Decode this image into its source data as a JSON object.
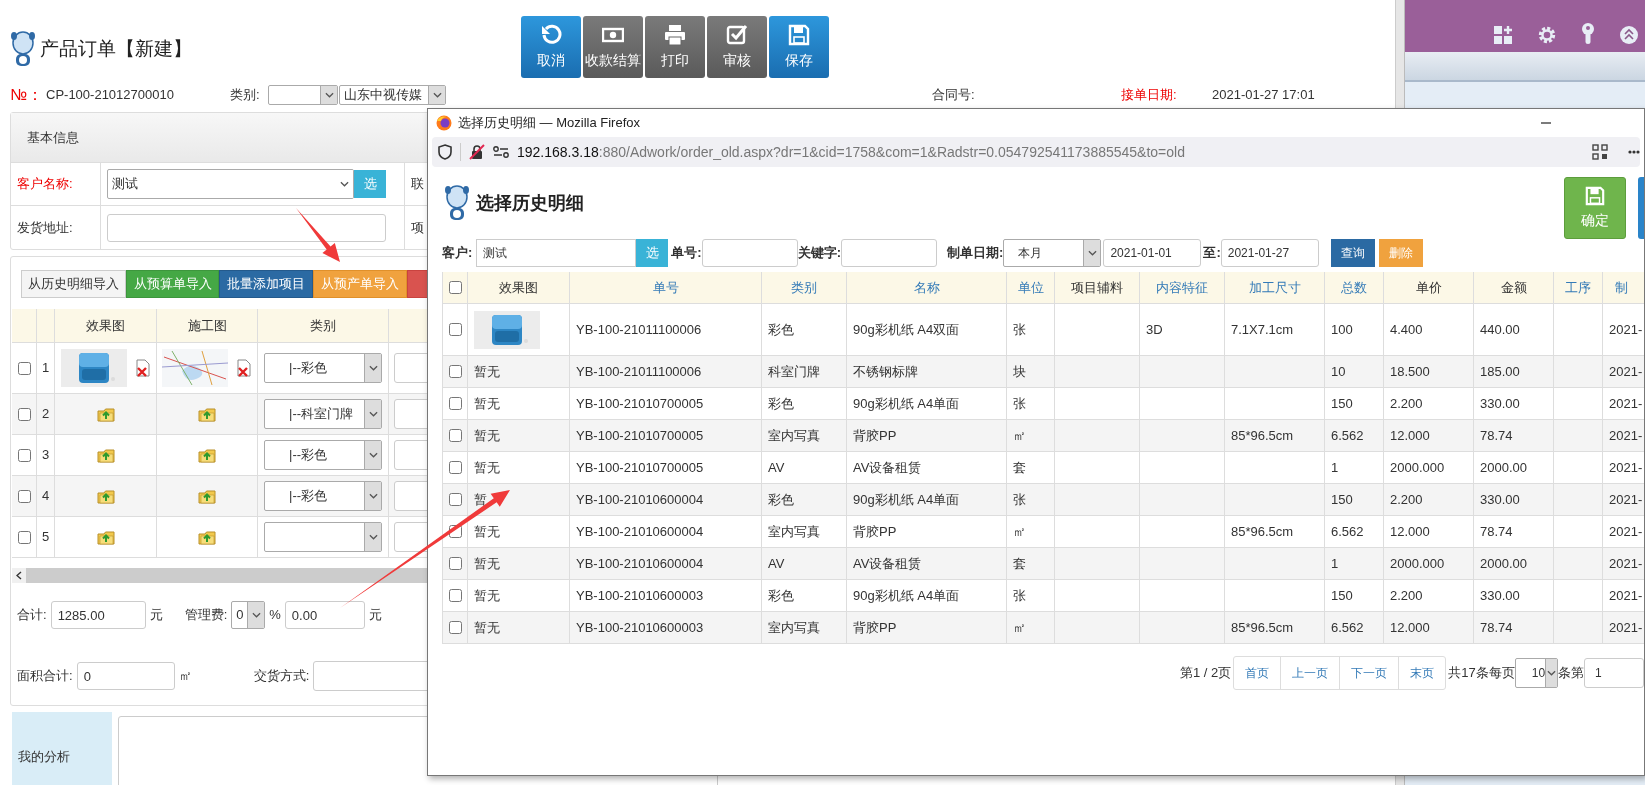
{
  "page": {
    "title": "产品订单【新建】",
    "toolbar": [
      {
        "label": "取消",
        "kind": "cancel"
      },
      {
        "label": "收款结算",
        "kind": "payment"
      },
      {
        "label": "打印",
        "kind": "print"
      },
      {
        "label": "审核",
        "kind": "review"
      },
      {
        "label": "保存",
        "kind": "save"
      }
    ],
    "order_line": {
      "number_label": "№：",
      "number": "CP-100-21012700010",
      "category_label": "类别:",
      "company": "山东中视传媒",
      "contract_label": "合同号:",
      "order_date_label": "接单日期:",
      "order_date": "2021-01-27 17:01"
    },
    "basic_info": {
      "title": "基本信息",
      "fields": [
        {
          "label": "客户名称:",
          "required": true,
          "value": "测试",
          "button": "选",
          "next_label": "联"
        },
        {
          "label": "发货地址:",
          "required": false,
          "next_label": "项"
        }
      ]
    },
    "detail": {
      "buttons": [
        {
          "label": "从历史明细导入",
          "kind": "history_import"
        },
        {
          "label": "从预算单导入",
          "kind": "budget_import"
        },
        {
          "label": "批量添加项目",
          "kind": "batch_add"
        },
        {
          "label": "从预产单导入",
          "kind": "preproduction_import"
        },
        {
          "kind": "other"
        }
      ],
      "columns": [
        "效果图",
        "施工图",
        "类别"
      ],
      "rows": [
        {
          "number": "1",
          "checked": false,
          "effect_image": true,
          "construction_image": true,
          "category": "|--彩色"
        },
        {
          "number": "2",
          "checked": false,
          "effect_image": false,
          "construction_image": false,
          "category": "|--科室门牌"
        },
        {
          "number": "3",
          "checked": false,
          "effect_image": false,
          "construction_image": false,
          "category": "|--彩色"
        },
        {
          "number": "4",
          "checked": false,
          "effect_image": false,
          "construction_image": false,
          "category": "|--彩色"
        },
        {
          "number": "5",
          "checked": false,
          "effect_image": false,
          "construction_image": false
        }
      ]
    },
    "totals": {
      "total_label": "合计:",
      "total": "1285.00",
      "total_unit": "元",
      "fee_label": "管理费:",
      "fee_rate": "0",
      "percent": "%",
      "fee": "0.00",
      "fee_unit": "元",
      "area_label": "面积合计:",
      "area": "0",
      "area_unit": "㎡",
      "delivery_label": "交货方式:"
    },
    "analysis": {
      "label": "我的分析"
    }
  },
  "popup": {
    "title": "选择历史明细 — Mozilla Firefox",
    "url_host": "192.168.3.18",
    "url_rest": ":880/Adwork/order_old.aspx?dr=1&cid=1758&com=1&Radstr=0.054792541173885545&to=old",
    "page_title": "选择历史明细",
    "confirm": "确定",
    "filters": {
      "customer_label": "客户:",
      "customer": "测试",
      "pick": "选",
      "order_no_label": "单号:",
      "keyword_label": "关键字:",
      "date_label": "制单日期:",
      "period": "本月",
      "date_from": "2021-01-01",
      "to_label": "至:",
      "date_to": "2021-01-27",
      "query": "查询",
      "delete": "删除"
    },
    "table": {
      "all_checked": false,
      "columns": [
        {
          "label": "效果图",
          "sortable": false
        },
        {
          "label": "单号",
          "sortable": true
        },
        {
          "label": "类别",
          "sortable": true
        },
        {
          "label": "名称",
          "sortable": true
        },
        {
          "label": "单位",
          "sortable": true
        },
        {
          "label": "项目辅料",
          "sortable": false
        },
        {
          "label": "内容特征",
          "sortable": true
        },
        {
          "label": "加工尺寸",
          "sortable": true
        },
        {
          "label": "总数",
          "sortable": true
        },
        {
          "label": "单价",
          "sortable": false
        },
        {
          "label": "金额",
          "sortable": false
        },
        {
          "label": "工序",
          "sortable": true
        },
        {
          "label": "制",
          "sortable": true
        }
      ],
      "rows": [
        {
          "checked": false,
          "has_image": true,
          "cells": [
            null,
            "YB-100-21011100006",
            "彩色",
            "90g彩机纸 A4双面",
            "张",
            null,
            "3D",
            "7.1X7.1cm",
            "100",
            "4.400",
            "440.00",
            null,
            "2021-"
          ]
        },
        {
          "checked": false,
          "has_image": false,
          "cells": [
            "暂无",
            "YB-100-21011100006",
            "科室门牌",
            "不锈钢标牌",
            "块",
            null,
            null,
            null,
            "10",
            "18.500",
            "185.00",
            null,
            "2021-"
          ]
        },
        {
          "checked": false,
          "has_image": false,
          "cells": [
            "暂无",
            "YB-100-21010700005",
            "彩色",
            "90g彩机纸 A4单面",
            "张",
            null,
            null,
            null,
            "150",
            "2.200",
            "330.00",
            null,
            "2021-"
          ]
        },
        {
          "checked": false,
          "has_image": false,
          "cells": [
            "暂无",
            "YB-100-21010700005",
            "室内写真",
            "背胶PP",
            "㎡",
            null,
            null,
            "85*96.5cm",
            "6.562",
            "12.000",
            "78.74",
            null,
            "2021-"
          ]
        },
        {
          "checked": false,
          "has_image": false,
          "cells": [
            "暂无",
            "YB-100-21010700005",
            "AV",
            "AV设备租赁",
            "套",
            null,
            null,
            null,
            "1",
            "2000.000",
            "2000.00",
            null,
            "2021-"
          ]
        },
        {
          "checked": false,
          "has_image": false,
          "cells": [
            "暂",
            "YB-100-21010600004",
            "彩色",
            "90g彩机纸 A4单面",
            "张",
            null,
            null,
            null,
            "150",
            "2.200",
            "330.00",
            null,
            "2021-"
          ]
        },
        {
          "checked": false,
          "has_image": false,
          "cells": [
            "暂无",
            "YB-100-21010600004",
            "室内写真",
            "背胶PP",
            "㎡",
            null,
            null,
            "85*96.5cm",
            "6.562",
            "12.000",
            "78.74",
            null,
            "2021-"
          ]
        },
        {
          "checked": false,
          "has_image": false,
          "cells": [
            "暂无",
            "YB-100-21010600004",
            "AV",
            "AV设备租赁",
            "套",
            null,
            null,
            null,
            "1",
            "2000.000",
            "2000.00",
            null,
            "2021-"
          ]
        },
        {
          "checked": false,
          "has_image": false,
          "cells": [
            "暂无",
            "YB-100-21010600003",
            "彩色",
            "90g彩机纸 A4单面",
            "张",
            null,
            null,
            null,
            "150",
            "2.200",
            "330.00",
            null,
            "2021-"
          ]
        },
        {
          "checked": false,
          "has_image": false,
          "cells": [
            "暂无",
            "YB-100-21010600003",
            "室内写真",
            "背胶PP",
            "㎡",
            null,
            null,
            "85*96.5cm",
            "6.562",
            "12.000",
            "78.74",
            null,
            "2021-"
          ]
        }
      ]
    },
    "pagination": {
      "page_info": "第1 / 2页",
      "links": [
        "首页",
        "上一页",
        "下一页",
        "末页"
      ],
      "total_info": "共17条每页",
      "page_size": "10",
      "page_label": "条第",
      "page": "1"
    }
  }
}
